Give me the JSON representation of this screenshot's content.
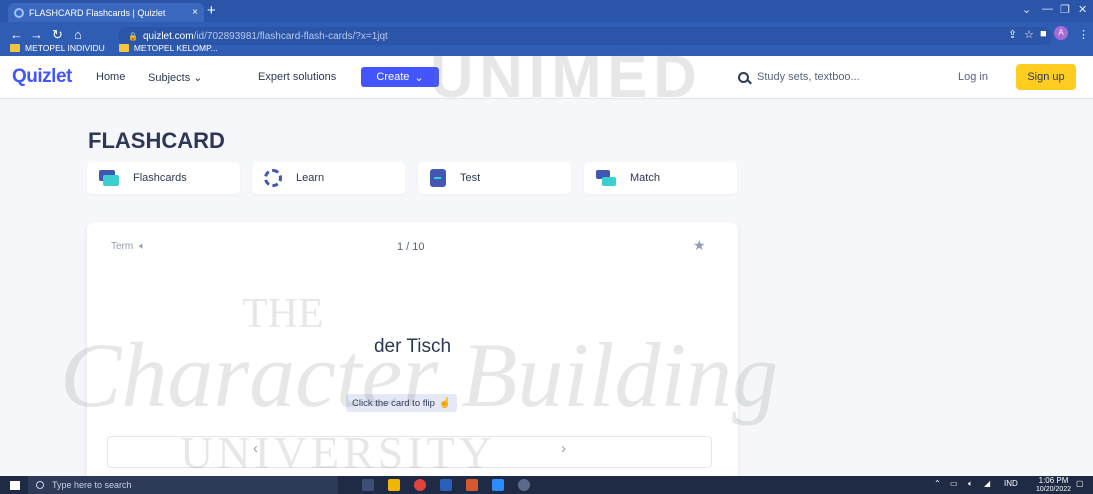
{
  "browser": {
    "tab_title": "FLASHCARD Flashcards | Quizlet",
    "tab_close": "×",
    "new_tab": "+",
    "url_host": "quizlet.com",
    "url_path": "/id/702893981/flashcard-flash-cards/?x=1jqt",
    "bookmarks": [
      "METOPEL INDIVIDU",
      "METOPEL KELOMP..."
    ],
    "profile_initial": "A"
  },
  "header": {
    "logo": "Quizlet",
    "nav": [
      "Home",
      "Subjects",
      "Expert solutions"
    ],
    "create": "Create",
    "search_placeholder": "Study sets, textboo...",
    "login": "Log in",
    "signup": "Sign up"
  },
  "set": {
    "title": "FLASHCARD",
    "modes": [
      "Flashcards",
      "Learn",
      "Test",
      "Match"
    ]
  },
  "card": {
    "side_label": "Term",
    "progress": "1 / 10",
    "word": "der Tisch",
    "hint": "Click the card to flip"
  },
  "taskbar": {
    "search_placeholder": "Type here to search",
    "lang": "IND",
    "time": "1:06 PM",
    "date": "10/20/2022"
  },
  "watermark": {
    "top": "UNIMED",
    "line1": "THE",
    "line2": "Character Building",
    "line3": "UNIVERSITY"
  }
}
